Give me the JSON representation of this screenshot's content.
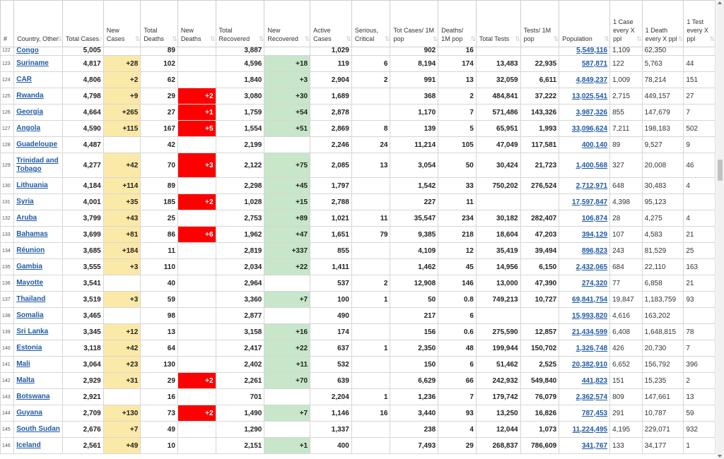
{
  "table": {
    "headers": [
      {
        "label": "#",
        "sort": ""
      },
      {
        "label": "Country, Other",
        "sort": "⇅"
      },
      {
        "label": "Total Cases",
        "sort": "↓↑"
      },
      {
        "label": "New Cases",
        "sort": "⇅"
      },
      {
        "label": "Total Deaths",
        "sort": "⇅"
      },
      {
        "label": "New Deaths",
        "sort": "⇅"
      },
      {
        "label": "Total Recovered",
        "sort": "⇅"
      },
      {
        "label": "New Recovered",
        "sort": "⇅"
      },
      {
        "label": "Active Cases",
        "sort": "⇅"
      },
      {
        "label": "Serious, Critical",
        "sort": "⇅"
      },
      {
        "label": "Tot Cases/ 1M pop",
        "sort": "⇅"
      },
      {
        "label": "Deaths/ 1M pop",
        "sort": "⇅"
      },
      {
        "label": "Total Tests",
        "sort": "⇅"
      },
      {
        "label": "Tests/ 1M pop",
        "sort": "⇅"
      },
      {
        "label": "Population",
        "sort": "⇅"
      },
      {
        "label": "1 Case every X ppl",
        "sort": "⇅"
      },
      {
        "label": "1 Death every X ppl",
        "sort": "⇅"
      },
      {
        "label": "1 Test every X ppl",
        "sort": "⇅"
      }
    ],
    "rows": [
      {
        "num": "122",
        "country": "Congo",
        "total_cases": "5,005",
        "new_cases": "",
        "total_deaths": "89",
        "new_deaths": "",
        "total_recovered": "3,887",
        "new_recovered": "",
        "active": "1,029",
        "serious": "",
        "cases_per_m": "902",
        "deaths_per_m": "16",
        "total_tests": "",
        "tests_per_m": "",
        "population": "5,549,116",
        "case_every": "1,109",
        "death_every": "62,350",
        "test_every": ""
      },
      {
        "num": "123",
        "country": "Suriname",
        "total_cases": "4,817",
        "new_cases": "+28",
        "total_deaths": "102",
        "new_deaths": "",
        "total_recovered": "4,596",
        "new_recovered": "+18",
        "active": "119",
        "serious": "6",
        "cases_per_m": "8,194",
        "deaths_per_m": "174",
        "total_tests": "13,483",
        "tests_per_m": "22,935",
        "population": "587,871",
        "case_every": "122",
        "death_every": "5,763",
        "test_every": "44"
      },
      {
        "num": "124",
        "country": "CAR",
        "total_cases": "4,806",
        "new_cases": "+2",
        "total_deaths": "62",
        "new_deaths": "",
        "total_recovered": "1,840",
        "new_recovered": "+3",
        "active": "2,904",
        "serious": "2",
        "cases_per_m": "991",
        "deaths_per_m": "13",
        "total_tests": "32,059",
        "tests_per_m": "6,611",
        "population": "4,849,237",
        "case_every": "1,009",
        "death_every": "78,214",
        "test_every": "151"
      },
      {
        "num": "125",
        "country": "Rwanda",
        "total_cases": "4,798",
        "new_cases": "+9",
        "total_deaths": "29",
        "new_deaths": "+2",
        "total_recovered": "3,080",
        "new_recovered": "+30",
        "active": "1,689",
        "serious": "",
        "cases_per_m": "368",
        "deaths_per_m": "2",
        "total_tests": "484,841",
        "tests_per_m": "37,222",
        "population": "13,025,541",
        "case_every": "2,715",
        "death_every": "449,157",
        "test_every": "27"
      },
      {
        "num": "126",
        "country": "Georgia",
        "total_cases": "4,664",
        "new_cases": "+265",
        "total_deaths": "27",
        "new_deaths": "+1",
        "total_recovered": "1,759",
        "new_recovered": "+54",
        "active": "2,878",
        "serious": "",
        "cases_per_m": "1,170",
        "deaths_per_m": "7",
        "total_tests": "571,486",
        "tests_per_m": "143,326",
        "population": "3,987,326",
        "case_every": "855",
        "death_every": "147,679",
        "test_every": "7"
      },
      {
        "num": "127",
        "country": "Angola",
        "total_cases": "4,590",
        "new_cases": "+115",
        "total_deaths": "167",
        "new_deaths": "+5",
        "total_recovered": "1,554",
        "new_recovered": "+51",
        "active": "2,869",
        "serious": "8",
        "cases_per_m": "139",
        "deaths_per_m": "5",
        "total_tests": "65,951",
        "tests_per_m": "1,993",
        "population": "33,096,624",
        "case_every": "7,211",
        "death_every": "198,183",
        "test_every": "502"
      },
      {
        "num": "128",
        "country": "Guadeloupe",
        "total_cases": "4,487",
        "new_cases": "",
        "total_deaths": "42",
        "new_deaths": "",
        "total_recovered": "2,199",
        "new_recovered": "",
        "active": "2,246",
        "serious": "24",
        "cases_per_m": "11,214",
        "deaths_per_m": "105",
        "total_tests": "47,049",
        "tests_per_m": "117,581",
        "population": "400,140",
        "case_every": "89",
        "death_every": "9,527",
        "test_every": "9"
      },
      {
        "num": "129",
        "country": "Trinidad and Tobago",
        "total_cases": "4,277",
        "new_cases": "+42",
        "total_deaths": "70",
        "new_deaths": "+3",
        "total_recovered": "2,122",
        "new_recovered": "+75",
        "active": "2,085",
        "serious": "13",
        "cases_per_m": "3,054",
        "deaths_per_m": "50",
        "total_tests": "30,424",
        "tests_per_m": "21,723",
        "population": "1,400,568",
        "case_every": "327",
        "death_every": "20,008",
        "test_every": "46"
      },
      {
        "num": "130",
        "country": "Lithuania",
        "total_cases": "4,184",
        "new_cases": "+114",
        "total_deaths": "89",
        "new_deaths": "",
        "total_recovered": "2,298",
        "new_recovered": "+45",
        "active": "1,797",
        "serious": "",
        "cases_per_m": "1,542",
        "deaths_per_m": "33",
        "total_tests": "750,202",
        "tests_per_m": "276,524",
        "population": "2,712,971",
        "case_every": "648",
        "death_every": "30,483",
        "test_every": "4"
      },
      {
        "num": "131",
        "country": "Syria",
        "total_cases": "4,001",
        "new_cases": "+35",
        "total_deaths": "185",
        "new_deaths": "+2",
        "total_recovered": "1,028",
        "new_recovered": "+15",
        "active": "2,788",
        "serious": "",
        "cases_per_m": "227",
        "deaths_per_m": "11",
        "total_tests": "",
        "tests_per_m": "",
        "population": "17,597,847",
        "case_every": "4,398",
        "death_every": "95,123",
        "test_every": ""
      },
      {
        "num": "132",
        "country": "Aruba",
        "total_cases": "3,799",
        "new_cases": "+43",
        "total_deaths": "25",
        "new_deaths": "",
        "total_recovered": "2,753",
        "new_recovered": "+89",
        "active": "1,021",
        "serious": "11",
        "cases_per_m": "35,547",
        "deaths_per_m": "234",
        "total_tests": "30,182",
        "tests_per_m": "282,407",
        "population": "106,874",
        "case_every": "28",
        "death_every": "4,275",
        "test_every": "4"
      },
      {
        "num": "133",
        "country": "Bahamas",
        "total_cases": "3,699",
        "new_cases": "+81",
        "total_deaths": "86",
        "new_deaths": "+6",
        "total_recovered": "1,962",
        "new_recovered": "+47",
        "active": "1,651",
        "serious": "79",
        "cases_per_m": "9,385",
        "deaths_per_m": "218",
        "total_tests": "18,604",
        "tests_per_m": "47,203",
        "population": "394,129",
        "case_every": "107",
        "death_every": "4,583",
        "test_every": "21"
      },
      {
        "num": "134",
        "country": "Réunion",
        "total_cases": "3,685",
        "new_cases": "+184",
        "total_deaths": "11",
        "new_deaths": "",
        "total_recovered": "2,819",
        "new_recovered": "+337",
        "active": "855",
        "serious": "",
        "cases_per_m": "4,109",
        "deaths_per_m": "12",
        "total_tests": "35,419",
        "tests_per_m": "39,494",
        "population": "896,823",
        "case_every": "243",
        "death_every": "81,529",
        "test_every": "25"
      },
      {
        "num": "135",
        "country": "Gambia",
        "total_cases": "3,555",
        "new_cases": "+3",
        "total_deaths": "110",
        "new_deaths": "",
        "total_recovered": "2,034",
        "new_recovered": "+22",
        "active": "1,411",
        "serious": "",
        "cases_per_m": "1,462",
        "deaths_per_m": "45",
        "total_tests": "14,956",
        "tests_per_m": "6,150",
        "population": "2,432,065",
        "case_every": "684",
        "death_every": "22,110",
        "test_every": "163"
      },
      {
        "num": "136",
        "country": "Mayotte",
        "total_cases": "3,541",
        "new_cases": "",
        "total_deaths": "40",
        "new_deaths": "",
        "total_recovered": "2,964",
        "new_recovered": "",
        "active": "537",
        "serious": "2",
        "cases_per_m": "12,908",
        "deaths_per_m": "146",
        "total_tests": "13,000",
        "tests_per_m": "47,390",
        "population": "274,320",
        "case_every": "77",
        "death_every": "6,858",
        "test_every": "21"
      },
      {
        "num": "137",
        "country": "Thailand",
        "total_cases": "3,519",
        "new_cases": "+3",
        "total_deaths": "59",
        "new_deaths": "",
        "total_recovered": "3,360",
        "new_recovered": "+7",
        "active": "100",
        "serious": "1",
        "cases_per_m": "50",
        "deaths_per_m": "0.8",
        "total_tests": "749,213",
        "tests_per_m": "10,727",
        "population": "69,841,754",
        "case_every": "19,847",
        "death_every": "1,183,759",
        "test_every": "93"
      },
      {
        "num": "138",
        "country": "Somalia",
        "total_cases": "3,465",
        "new_cases": "",
        "total_deaths": "98",
        "new_deaths": "",
        "total_recovered": "2,877",
        "new_recovered": "",
        "active": "490",
        "serious": "",
        "cases_per_m": "217",
        "deaths_per_m": "6",
        "total_tests": "",
        "tests_per_m": "",
        "population": "15,993,820",
        "case_every": "4,616",
        "death_every": "163,202",
        "test_every": ""
      },
      {
        "num": "139",
        "country": "Sri Lanka",
        "total_cases": "3,345",
        "new_cases": "+12",
        "total_deaths": "13",
        "new_deaths": "",
        "total_recovered": "3,158",
        "new_recovered": "+16",
        "active": "174",
        "serious": "",
        "cases_per_m": "156",
        "deaths_per_m": "0.6",
        "total_tests": "275,590",
        "tests_per_m": "12,857",
        "population": "21,434,599",
        "case_every": "6,408",
        "death_every": "1,648,815",
        "test_every": "78"
      },
      {
        "num": "140",
        "country": "Estonia",
        "total_cases": "3,118",
        "new_cases": "+42",
        "total_deaths": "64",
        "new_deaths": "",
        "total_recovered": "2,417",
        "new_recovered": "+22",
        "active": "637",
        "serious": "1",
        "cases_per_m": "2,350",
        "deaths_per_m": "48",
        "total_tests": "199,944",
        "tests_per_m": "150,702",
        "population": "1,326,748",
        "case_every": "426",
        "death_every": "20,730",
        "test_every": "7"
      },
      {
        "num": "141",
        "country": "Mali",
        "total_cases": "3,064",
        "new_cases": "+23",
        "total_deaths": "130",
        "new_deaths": "",
        "total_recovered": "2,402",
        "new_recovered": "+11",
        "active": "532",
        "serious": "",
        "cases_per_m": "150",
        "deaths_per_m": "6",
        "total_tests": "51,462",
        "tests_per_m": "2,525",
        "population": "20,382,910",
        "case_every": "6,652",
        "death_every": "156,792",
        "test_every": "396"
      },
      {
        "num": "142",
        "country": "Malta",
        "total_cases": "2,929",
        "new_cases": "+31",
        "total_deaths": "29",
        "new_deaths": "+2",
        "total_recovered": "2,261",
        "new_recovered": "+70",
        "active": "639",
        "serious": "",
        "cases_per_m": "6,629",
        "deaths_per_m": "66",
        "total_tests": "242,932",
        "tests_per_m": "549,840",
        "population": "441,823",
        "case_every": "151",
        "death_every": "15,235",
        "test_every": "2"
      },
      {
        "num": "143",
        "country": "Botswana",
        "total_cases": "2,921",
        "new_cases": "",
        "total_deaths": "16",
        "new_deaths": "",
        "total_recovered": "701",
        "new_recovered": "",
        "active": "2,204",
        "serious": "1",
        "cases_per_m": "1,236",
        "deaths_per_m": "7",
        "total_tests": "179,742",
        "tests_per_m": "76,079",
        "population": "2,362,574",
        "case_every": "809",
        "death_every": "147,661",
        "test_every": "13"
      },
      {
        "num": "144",
        "country": "Guyana",
        "total_cases": "2,709",
        "new_cases": "+130",
        "total_deaths": "73",
        "new_deaths": "+2",
        "total_recovered": "1,490",
        "new_recovered": "+7",
        "active": "1,146",
        "serious": "16",
        "cases_per_m": "3,440",
        "deaths_per_m": "93",
        "total_tests": "13,250",
        "tests_per_m": "16,826",
        "population": "787,453",
        "case_every": "291",
        "death_every": "10,787",
        "test_every": "59"
      },
      {
        "num": "145",
        "country": "South Sudan",
        "total_cases": "2,676",
        "new_cases": "+7",
        "total_deaths": "49",
        "new_deaths": "",
        "total_recovered": "1,290",
        "new_recovered": "",
        "active": "1,337",
        "serious": "",
        "cases_per_m": "238",
        "deaths_per_m": "4",
        "total_tests": "12,044",
        "tests_per_m": "1,073",
        "population": "11,224,495",
        "case_every": "4,195",
        "death_every": "229,071",
        "test_every": "932"
      },
      {
        "num": "146",
        "country": "Iceland",
        "total_cases": "2,561",
        "new_cases": "+49",
        "total_deaths": "10",
        "new_deaths": "",
        "total_recovered": "2,151",
        "new_recovered": "+1",
        "active": "400",
        "serious": "",
        "cases_per_m": "7,493",
        "deaths_per_m": "29",
        "total_tests": "268,837",
        "tests_per_m": "786,609",
        "population": "341,767",
        "case_every": "133",
        "death_every": "34,177",
        "test_every": "1"
      }
    ]
  },
  "colors": {
    "new_cases_bg": "#fbe9a7",
    "new_deaths_bg": "#ff0000",
    "new_recovered_bg": "#c8e6c9",
    "link": "#1f5aa6"
  }
}
